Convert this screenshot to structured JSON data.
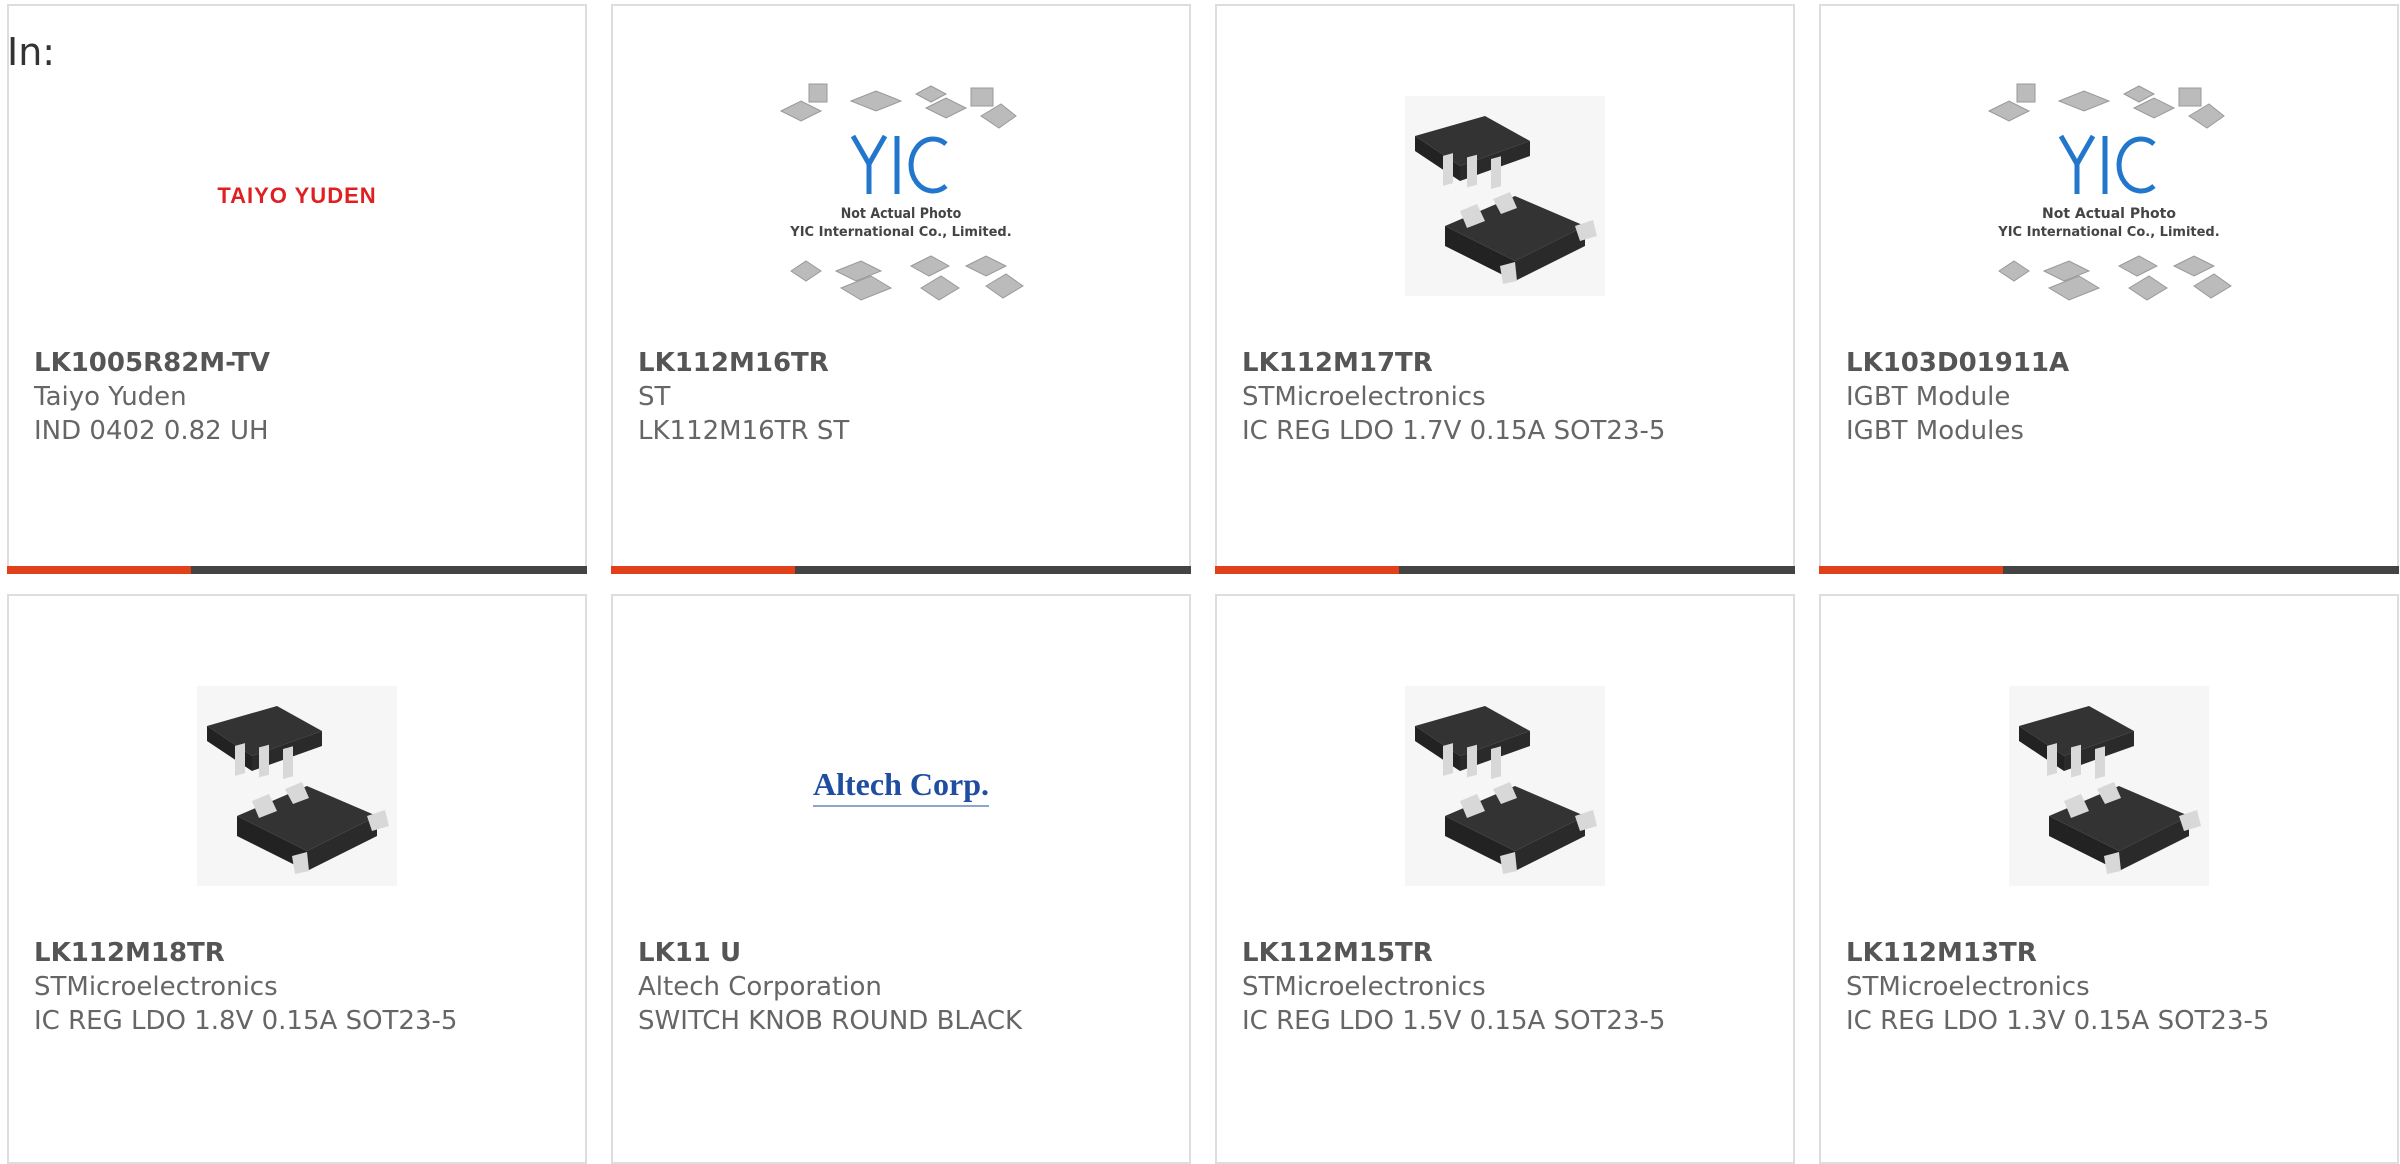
{
  "header": {
    "in_label": "In:"
  },
  "products": [
    {
      "part_number": "LK1005R82M-TV",
      "manufacturer": "Taiyo Yuden",
      "description": "IND 0402 0.82 UH",
      "image": {
        "type": "logo",
        "icon": "taiyo-yuden-logo-icon",
        "text": "TAIYO YUDEN"
      }
    },
    {
      "part_number": "LK112M16TR",
      "manufacturer": "ST",
      "description": "LK112M16TR ST",
      "image": {
        "type": "placeholder",
        "icon": "yic-placeholder-icon",
        "line1": "Not Actual Photo",
        "line2": "YIC International Co., Limited."
      }
    },
    {
      "part_number": "LK112M17TR",
      "manufacturer": "STMicroelectronics",
      "description": "IC REG LDO 1.7V 0.15A SOT23-5",
      "image": {
        "type": "chip",
        "icon": "sot23-chip-icon"
      }
    },
    {
      "part_number": "LK103D01911A",
      "manufacturer": "IGBT Module",
      "description": "IGBT Modules",
      "image": {
        "type": "placeholder",
        "icon": "yic-placeholder-icon",
        "line1": "Not Actual Photo",
        "line2": "YIC International Co., Limited."
      }
    },
    {
      "part_number": "LK112M18TR",
      "manufacturer": "STMicroelectronics",
      "description": "IC REG LDO 1.8V 0.15A SOT23-5",
      "image": {
        "type": "chip",
        "icon": "sot23-chip-icon"
      }
    },
    {
      "part_number": "LK11 U",
      "manufacturer": "Altech Corporation",
      "description": "SWITCH KNOB ROUND BLACK",
      "image": {
        "type": "logo",
        "icon": "altech-logo-icon",
        "text": "Altech Corp."
      }
    },
    {
      "part_number": "LK112M15TR",
      "manufacturer": "STMicroelectronics",
      "description": "IC REG LDO 1.5V 0.15A SOT23-5",
      "image": {
        "type": "chip",
        "icon": "sot23-chip-icon"
      }
    },
    {
      "part_number": "LK112M13TR",
      "manufacturer": "STMicroelectronics",
      "description": "IC REG LDO 1.3V 0.15A SOT23-5",
      "image": {
        "type": "chip",
        "icon": "sot23-chip-icon"
      }
    }
  ],
  "colors": {
    "accent": "#e0401a",
    "bar": "#444444",
    "border": "#dddddd",
    "text": "#666666"
  }
}
